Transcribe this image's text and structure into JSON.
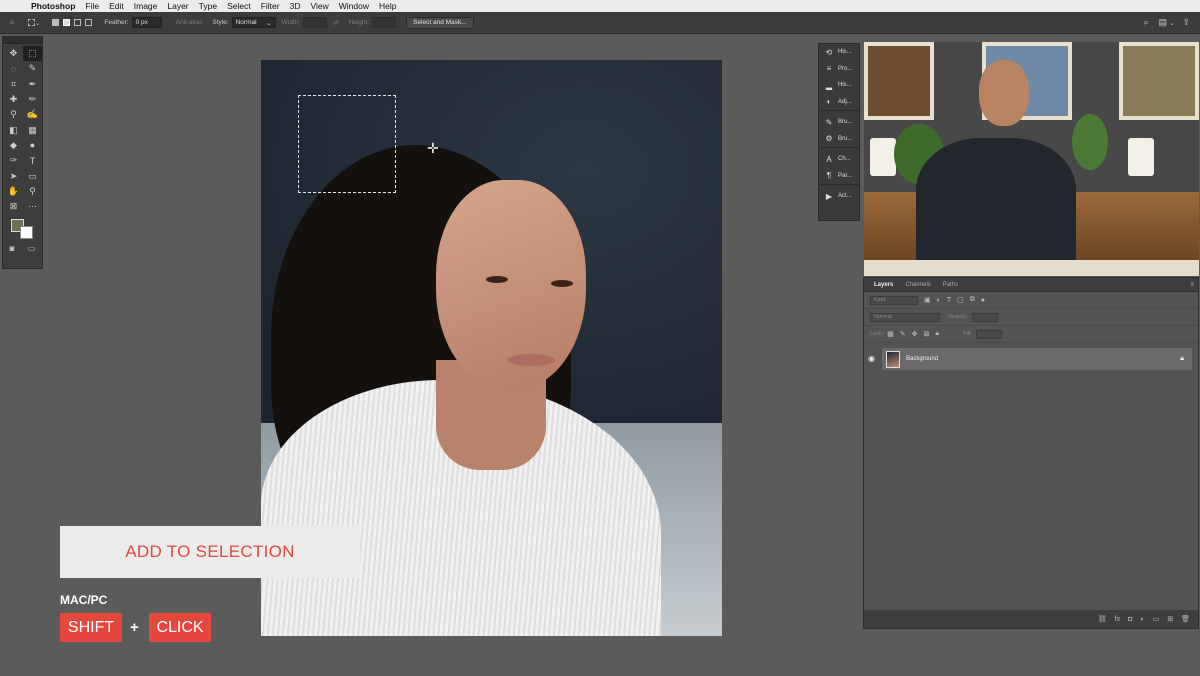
{
  "menubar": {
    "app_name": "Photoshop",
    "items": [
      "File",
      "Edit",
      "Image",
      "Layer",
      "Type",
      "Select",
      "Filter",
      "3D",
      "View",
      "Window",
      "Help"
    ]
  },
  "options_bar": {
    "feather_label": "Feather:",
    "feather_value": "0 px",
    "anti_alias_label": "Anti-alias",
    "style_label": "Style:",
    "style_value": "Normal",
    "width_label": "Width:",
    "height_label": "Height:",
    "select_mask_label": "Select and Mask..."
  },
  "tools": {
    "icons": [
      "move-icon",
      "marquee-icon",
      "lasso-icon",
      "quick-select-icon",
      "crop-icon",
      "eyedropper-icon",
      "healing-icon",
      "brush-icon",
      "stamp-icon",
      "history-brush-icon",
      "eraser-icon",
      "gradient-icon",
      "blur-icon",
      "dodge-icon",
      "pen-icon",
      "type-icon",
      "path-select-icon",
      "shape-icon",
      "hand-icon",
      "zoom-icon",
      "frame-icon",
      "more-icon"
    ],
    "glyphs": [
      "✥",
      "⬚",
      "◌",
      "✎",
      "⌗",
      "✒",
      "✚",
      "✏",
      "⚲",
      "✍",
      "◧",
      "▦",
      "◆",
      "●",
      "✑",
      "T",
      "➤",
      "▭",
      "✋",
      "⚲",
      "⊠",
      "⋯"
    ],
    "foreground_color": "#6b7357",
    "background_color": "#ffffff"
  },
  "panel_strip": {
    "items": [
      {
        "icon": "history-icon",
        "glyph": "⟲",
        "label": "His..."
      },
      {
        "icon": "properties-icon",
        "glyph": "≡",
        "label": "Pro..."
      },
      {
        "icon": "histogram-icon",
        "glyph": "▂",
        "label": "His..."
      },
      {
        "icon": "adjustments-icon",
        "glyph": "◐",
        "label": "Adj..."
      },
      {
        "icon": "brush-icon",
        "glyph": "✎",
        "label": "Bru..."
      },
      {
        "icon": "brush-settings-icon",
        "glyph": "⚙",
        "label": "Bru..."
      },
      {
        "icon": "character-icon",
        "glyph": "A",
        "label": "Ch..."
      },
      {
        "icon": "paragraph-icon",
        "glyph": "¶",
        "label": "Par..."
      },
      {
        "icon": "actions-icon",
        "glyph": "▶",
        "label": "Act..."
      }
    ]
  },
  "layers_panel": {
    "tabs": [
      "Layers",
      "Channels",
      "Paths"
    ],
    "kind_placeholder": "Kind",
    "blend_mode": "Normal",
    "opacity_label": "Opacity:",
    "lock_label": "Lock:",
    "fill_label": "Fill:",
    "layer_name": "Background"
  },
  "overlay": {
    "title": "ADD TO SELECTION",
    "platform": "MAC/PC",
    "key1": "SHIFT",
    "plus": "+",
    "key2": "CLICK",
    "accent_color": "#e3473d"
  }
}
